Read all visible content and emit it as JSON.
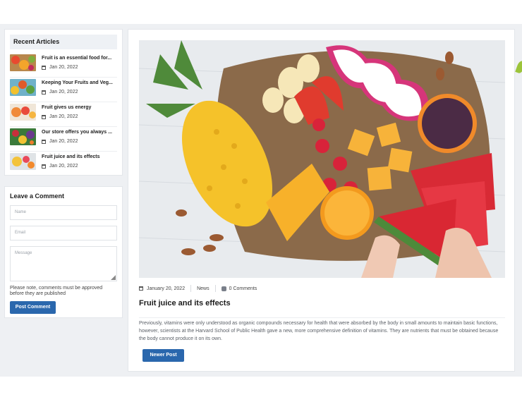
{
  "sidebar": {
    "recent": {
      "heading": "Recent Articles",
      "items": [
        {
          "title": "Fruit is an essential food for...",
          "date": "Jan 20, 2022"
        },
        {
          "title": "Keeping Your Fruits and Veg...",
          "date": "Jan 20, 2022"
        },
        {
          "title": "Fruit gives us energy",
          "date": "Jan 20, 2022"
        },
        {
          "title": "Our store offers you always ...",
          "date": "Jan 20, 2022"
        },
        {
          "title": "Fruit juice and its effects",
          "date": "Jan 20, 2022"
        }
      ]
    },
    "comment": {
      "heading": "Leave a Comment",
      "name_placeholder": "Name",
      "email_placeholder": "Email",
      "message_placeholder": "Message",
      "note": "Please note, comments must be approved before they are published",
      "submit_label": "Post Comment"
    }
  },
  "post": {
    "date": "January 20, 2022",
    "category": "News",
    "comments": "0 Comments",
    "title": "Fruit juice and its effects",
    "body": "Previously, vitamins were only understood as organic compounds necessary for health that were absorbed by the body in small amounts to maintain basic functions, however, scientists at the Harvard School of Public Health gave a new, more comprehensive definition of vitamins. They are nutrients that must be obtained because the body cannot produce it on its own.",
    "newer_label": "Newer Post"
  },
  "colors": {
    "accent": "#2a67ad",
    "page_bg": "#eef0f3"
  },
  "icons": [
    "calendar-icon",
    "comment-icon",
    "resize-handle-icon"
  ]
}
